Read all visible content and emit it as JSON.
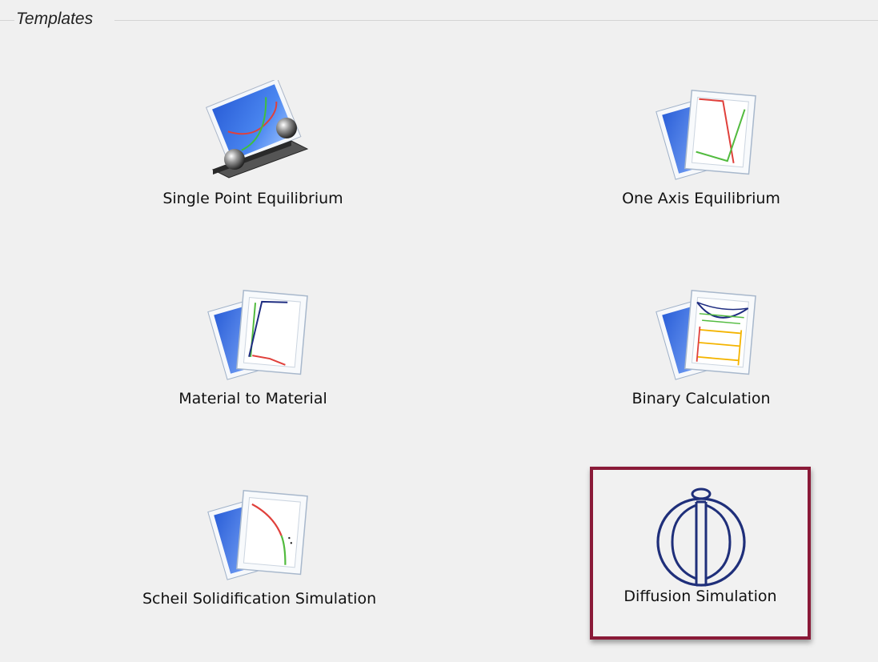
{
  "group": {
    "title": "Templates"
  },
  "templates": [
    {
      "label": "Single Point Equilibrium",
      "icon": "single-point-equilibrium-icon",
      "selected": false
    },
    {
      "label": "One Axis Equilibrium",
      "icon": "one-axis-equilibrium-icon",
      "selected": false
    },
    {
      "label": "Material to Material",
      "icon": "material-to-material-icon",
      "selected": false
    },
    {
      "label": "Binary Calculation",
      "icon": "binary-calculation-icon",
      "selected": false
    },
    {
      "label": "Scheil Solidification Simulation",
      "icon": "scheil-solidification-icon",
      "selected": false
    },
    {
      "label": "Diffusion Simulation",
      "icon": "diffusion-simulation-icon",
      "selected": true
    }
  ],
  "colors": {
    "selection_border": "#8a1a38",
    "diffusion_logo": "#1f2f7a"
  }
}
